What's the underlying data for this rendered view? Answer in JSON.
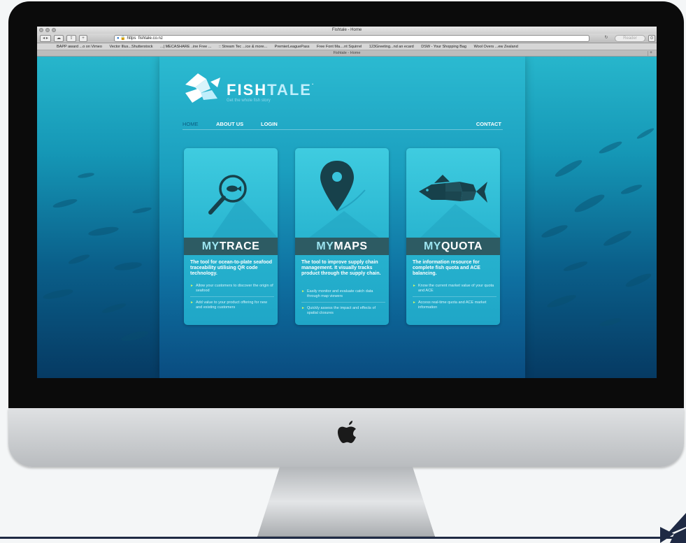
{
  "browser": {
    "window_title": "Fishtale - Home",
    "url": "https  fishtale.co.nz",
    "reader_label": "Reader",
    "tab_title": "Fishtale - Home",
    "bookmarks": [
      "BAPP award ...o on Vimeo",
      "Vector Illus...Shutterstock",
      "...| MECASHARE ..ine Free ...",
      ":: Stream Tec ...ice & more...",
      "PremierLeaguePass",
      "Free Font Ma....nt Squirrel",
      "123Greeting...nd an ecard",
      "DSW - Your Shopping Bag",
      "Wool Overs ...ew Zealand"
    ]
  },
  "site": {
    "brand_fish": "FISH",
    "brand_tale": "TALE",
    "brand_mark": "·",
    "tagline": "Get the whole fish story",
    "nav": {
      "home": "HOME",
      "about": "ABOUT US",
      "login": "LOGIN",
      "contact": "CONTACT"
    },
    "cards": [
      {
        "my": "MY",
        "name": "TRACE",
        "desc": "The tool for ocean-to-plate seafood traceability utilising QR code technology.",
        "bullets": [
          "Allow your customers to discover the origin of seafood",
          "Add value to your product offering for new and existing customers"
        ]
      },
      {
        "my": "MY",
        "name": "MAPS",
        "desc": "The tool to improve supply chain management. It visually tracks product through the supply chain.",
        "bullets": [
          "Easily monitor and evaluate catch data through map viewers",
          "Quickly assess the impact and effects of spatial closures"
        ]
      },
      {
        "my": "MY",
        "name": "QUOTA",
        "desc": "The information resource for complete fish quota and ACE balancing.",
        "bullets": [
          "Know the current market value of your quota and ACE",
          "Access real-time quota and ACE market information"
        ]
      }
    ]
  },
  "colors": {
    "accent": "#cdf46b",
    "bar": "#2d5b63",
    "sea_top": "#27b6cc",
    "sea_bottom": "#063a63"
  }
}
